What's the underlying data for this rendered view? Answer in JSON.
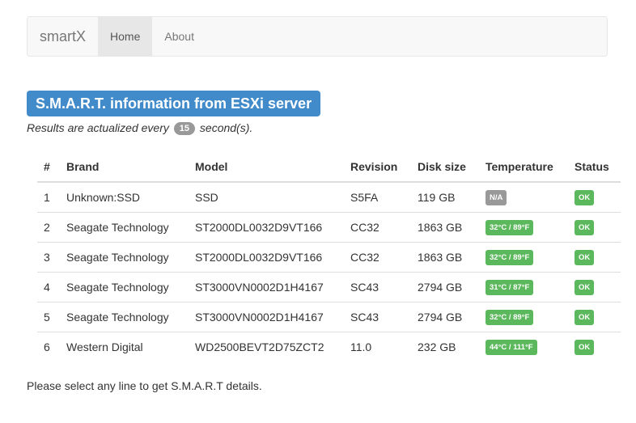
{
  "navbar": {
    "brand": "smartX",
    "items": [
      {
        "label": "Home",
        "active": true
      },
      {
        "label": "About",
        "active": false
      }
    ]
  },
  "headline": "S.M.A.R.T. information from ESXi server",
  "refresh": {
    "prefix": "Results are actualized every",
    "seconds": "15",
    "suffix": "second(s)."
  },
  "table": {
    "headers": [
      "#",
      "Brand",
      "Model",
      "Revision",
      "Disk size",
      "Temperature",
      "Status"
    ],
    "rows": [
      {
        "num": "1",
        "brand": "Unknown:SSD",
        "model": "SSD",
        "revision": "S5FA",
        "size": "119 GB",
        "temperature": "N/A",
        "temp_style": "default",
        "status": "OK"
      },
      {
        "num": "2",
        "brand": "Seagate Technology",
        "model": "ST2000DL0032D9VT166",
        "revision": "CC32",
        "size": "1863 GB",
        "temperature": "32°C / 89°F",
        "temp_style": "success",
        "status": "OK"
      },
      {
        "num": "3",
        "brand": "Seagate Technology",
        "model": "ST2000DL0032D9VT166",
        "revision": "CC32",
        "size": "1863 GB",
        "temperature": "32°C / 89°F",
        "temp_style": "success",
        "status": "OK"
      },
      {
        "num": "4",
        "brand": "Seagate Technology",
        "model": "ST3000VN0002D1H4167",
        "revision": "SC43",
        "size": "2794 GB",
        "temperature": "31°C / 87°F",
        "temp_style": "success",
        "status": "OK"
      },
      {
        "num": "5",
        "brand": "Seagate Technology",
        "model": "ST3000VN0002D1H4167",
        "revision": "SC43",
        "size": "2794 GB",
        "temperature": "32°C / 89°F",
        "temp_style": "success",
        "status": "OK"
      },
      {
        "num": "6",
        "brand": "Western Digital",
        "model": "WD2500BEVT2D75ZCT2",
        "revision": "11.0",
        "size": "232 GB",
        "temperature": "44°C / 111°F",
        "temp_style": "success",
        "status": "OK"
      }
    ]
  },
  "footer_note": "Please select any line to get S.M.A.R.T details.",
  "colors": {
    "headline_bg": "#428bca",
    "success": "#5cb85c",
    "default_badge": "#999999"
  }
}
